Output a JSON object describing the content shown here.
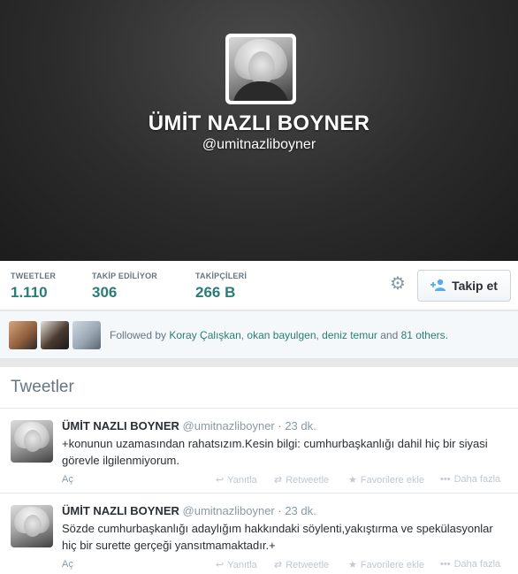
{
  "profile": {
    "name": "ÜMİT NAZLI BOYNER",
    "handle": "@umitnazliboyner"
  },
  "stats": {
    "tweets_label": "TWEETLER",
    "tweets_value": "1.110",
    "following_label": "TAKİP EDİLİYOR",
    "following_value": "306",
    "followers_label": "TAKİPÇİLERİ",
    "followers_value": "266 B"
  },
  "actions": {
    "follow_label": "Takip et"
  },
  "followed_by": {
    "prefix": "Followed by",
    "user1": "Koray Çalışkan",
    "user2": "okan bayulgen",
    "user3": "deniz temur",
    "and": "and",
    "others": "81 others."
  },
  "timeline": {
    "title": "Tweetler"
  },
  "tweets": [
    {
      "name": "ÜMİT NAZLI BOYNER",
      "handle": "@umitnazliboyner",
      "time": "· 23 dk.",
      "text": "+konunun uzamasından rahatsızım.Kesin bilgi: cumhurbaşkanlığı dahil hiç bir siyasi görevle ilgilenmiyorum.",
      "expand": "Aç",
      "reply": "Yanıtla",
      "retweet": "Retweetle",
      "favorite": "Favorilere ekle",
      "more": "Daha fazla"
    },
    {
      "name": "ÜMİT NAZLI BOYNER",
      "handle": "@umitnazliboyner",
      "time": "· 23 dk.",
      "text": "Sözde cumhurbaşkanlığı adaylığım hakkındaki söylenti,yakıştırma ve spekülasyonlar hiç bir surette gerçeği yansıtmamaktadır.+",
      "expand": "Aç",
      "reply": "Yanıtla",
      "retweet": "Retweetle",
      "favorite": "Favorilere ekle",
      "more": "Daha fazla"
    }
  ],
  "colors": {
    "accent": "#2a7d74",
    "link_blue": "#55acee",
    "muted": "#8899a6"
  },
  "icons": [
    "gear-icon",
    "add-person-icon",
    "reply-icon",
    "retweet-icon",
    "star-icon",
    "more-icon"
  ]
}
